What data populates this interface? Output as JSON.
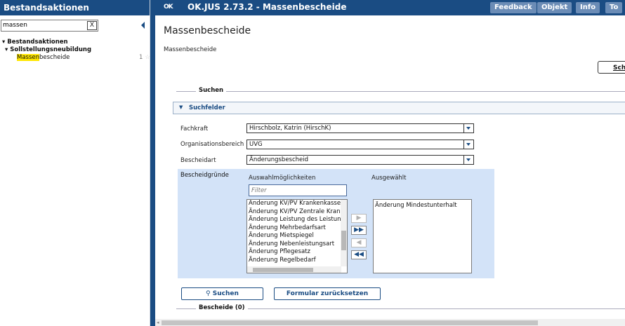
{
  "left_panel": {
    "title": "Bestandsaktionen",
    "search_value": "massen",
    "clear_label": "X",
    "tree": {
      "level1": "Bestandsaktionen",
      "level2": "Sollstellungsneubildung",
      "leaf_highlight": "Massen",
      "leaf_rest": "bescheide",
      "leaf_count": "1",
      "star": "☆"
    }
  },
  "header": {
    "logo": "OK",
    "app_title": "OK.JUS 2.73.2 - Massenbescheide",
    "buttons": [
      "Feedback",
      "Objekt",
      "Info",
      "To"
    ]
  },
  "page": {
    "title": "Massenbescheide",
    "breadcrumb": "Massenbescheide",
    "close_button": "Schl"
  },
  "search_section": {
    "legend": "Suchen",
    "panel_title": "Suchfelder",
    "fields": {
      "fachkraft_label": "Fachkraft",
      "fachkraft_value": "Hirschbolz, Katrin (HirschK)",
      "orgbereich_label": "Organisationsbereich",
      "orgbereich_value": "UVG",
      "bescheidart_label": "Bescheidart",
      "bescheidart_value": "Änderungsbescheid",
      "bescheidgruende_label": "Bescheidgründe"
    },
    "available_header": "Auswahlmöglichkeiten",
    "selected_header": "Ausgewählt",
    "filter_placeholder": "Filter",
    "available_items": [
      "Änderung KV/PV Krankenkasse",
      "Änderung KV/PV Zentrale Krank",
      "Änderung Leistung des Leistung",
      "Änderung Mehrbedarfsart",
      "Änderung Mietspiegel",
      "Änderung Nebenleistungsart",
      "Änderung Pflegesatz",
      "Änderung Regelbedarf"
    ],
    "selected_items": [
      "Änderung Mindestunterhalt"
    ],
    "move_buttons": {
      "add": "▶",
      "add_all": "▶▶",
      "remove": "◀",
      "remove_all": "◀◀"
    },
    "search_button": "Suchen",
    "reset_button": "Formular zurücksetzen"
  },
  "results_section": {
    "legend": "Bescheide (0)"
  }
}
